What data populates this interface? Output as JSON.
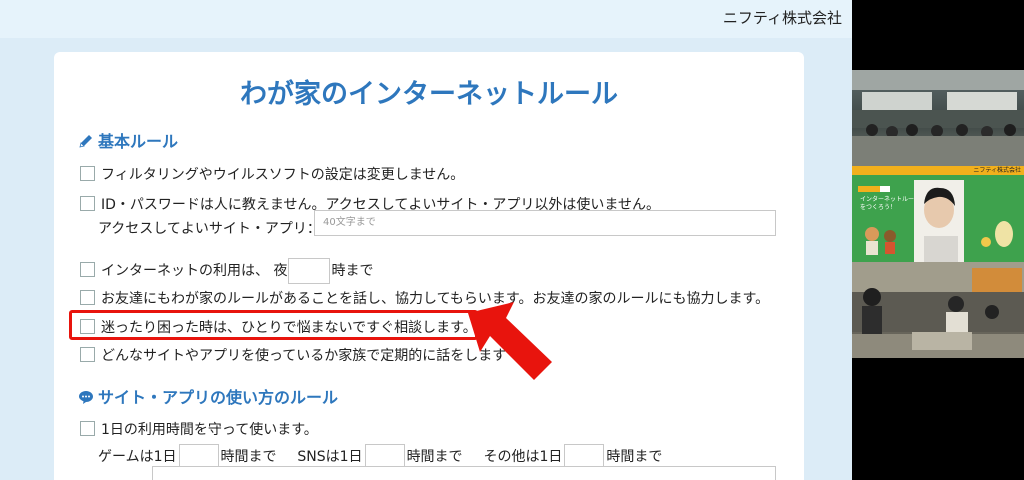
{
  "header": {
    "company": "ニフティ株式会社"
  },
  "card": {
    "title": "わが家のインターネットルール"
  },
  "section1": {
    "title": "基本ルール",
    "icon": "pencil-icon",
    "items": [
      "フィルタリングやウイルスソフトの設定は変更しません。",
      "ID・パスワードは人に教えません。アクセスしてよいサイト・アプリ以外は使いません。",
      "インターネットの利用は、 夜",
      "お友達にもわが家のルールがあることを話し、協力してもらいます。お友達の家のルールにも協力します。",
      "迷ったり困った時は、ひとりで悩まないですぐ相談します。",
      "どんなサイトやアプリを使っているか家族で定期的に話をします"
    ],
    "site_label": "アクセスしてよいサイト・アプリ：",
    "site_placeholder": "40文字まで",
    "time_suffix": "時まで"
  },
  "section2": {
    "title": "サイト・アプリの使い方のルール",
    "icon": "speech-bubble-icon",
    "item1": "1日の利用時間を守って使います。",
    "game_label": "ゲームは1日",
    "sns_label": "SNSは1日",
    "other_label": "その他は1日",
    "unit": "時間まで"
  },
  "video": {
    "slide_header": "ニフティ株式会社",
    "slide_title": "インターネットルールをつくろう！"
  },
  "colors": {
    "accent": "#2e77bd",
    "highlight": "#e8140d"
  }
}
